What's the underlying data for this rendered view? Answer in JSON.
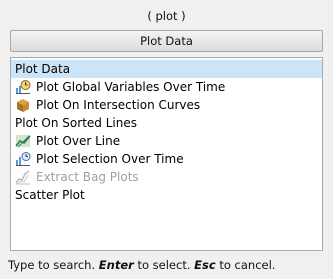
{
  "window": {
    "title": "( plot )"
  },
  "filter": {
    "label": "Plot Data"
  },
  "list": {
    "items": [
      {
        "label": "Plot Data",
        "icon": "none",
        "selected": true,
        "disabled": false
      },
      {
        "label": "Plot Global Variables Over Time",
        "icon": "clock-chart-icon",
        "selected": false,
        "disabled": false
      },
      {
        "label": "Plot On Intersection Curves",
        "icon": "box-icon",
        "selected": false,
        "disabled": false
      },
      {
        "label": "Plot On Sorted Lines",
        "icon": "none",
        "selected": false,
        "disabled": false
      },
      {
        "label": "Plot Over Line",
        "icon": "line-plot-icon",
        "selected": false,
        "disabled": false
      },
      {
        "label": "Plot Selection Over Time",
        "icon": "selection-time-icon",
        "selected": false,
        "disabled": false
      },
      {
        "label": "Extract Bag Plots",
        "icon": "bag-plot-icon",
        "selected": false,
        "disabled": true
      },
      {
        "label": "Scatter Plot",
        "icon": "none",
        "selected": false,
        "disabled": false
      }
    ]
  },
  "status": {
    "prefix": "Type to search.",
    "enter_key": "Enter",
    "enter_text": "to select.",
    "esc_key": "Esc",
    "esc_text": "to cancel."
  },
  "colors": {
    "selection": "#cce4f7",
    "disabled_text": "#a0a0a0"
  }
}
